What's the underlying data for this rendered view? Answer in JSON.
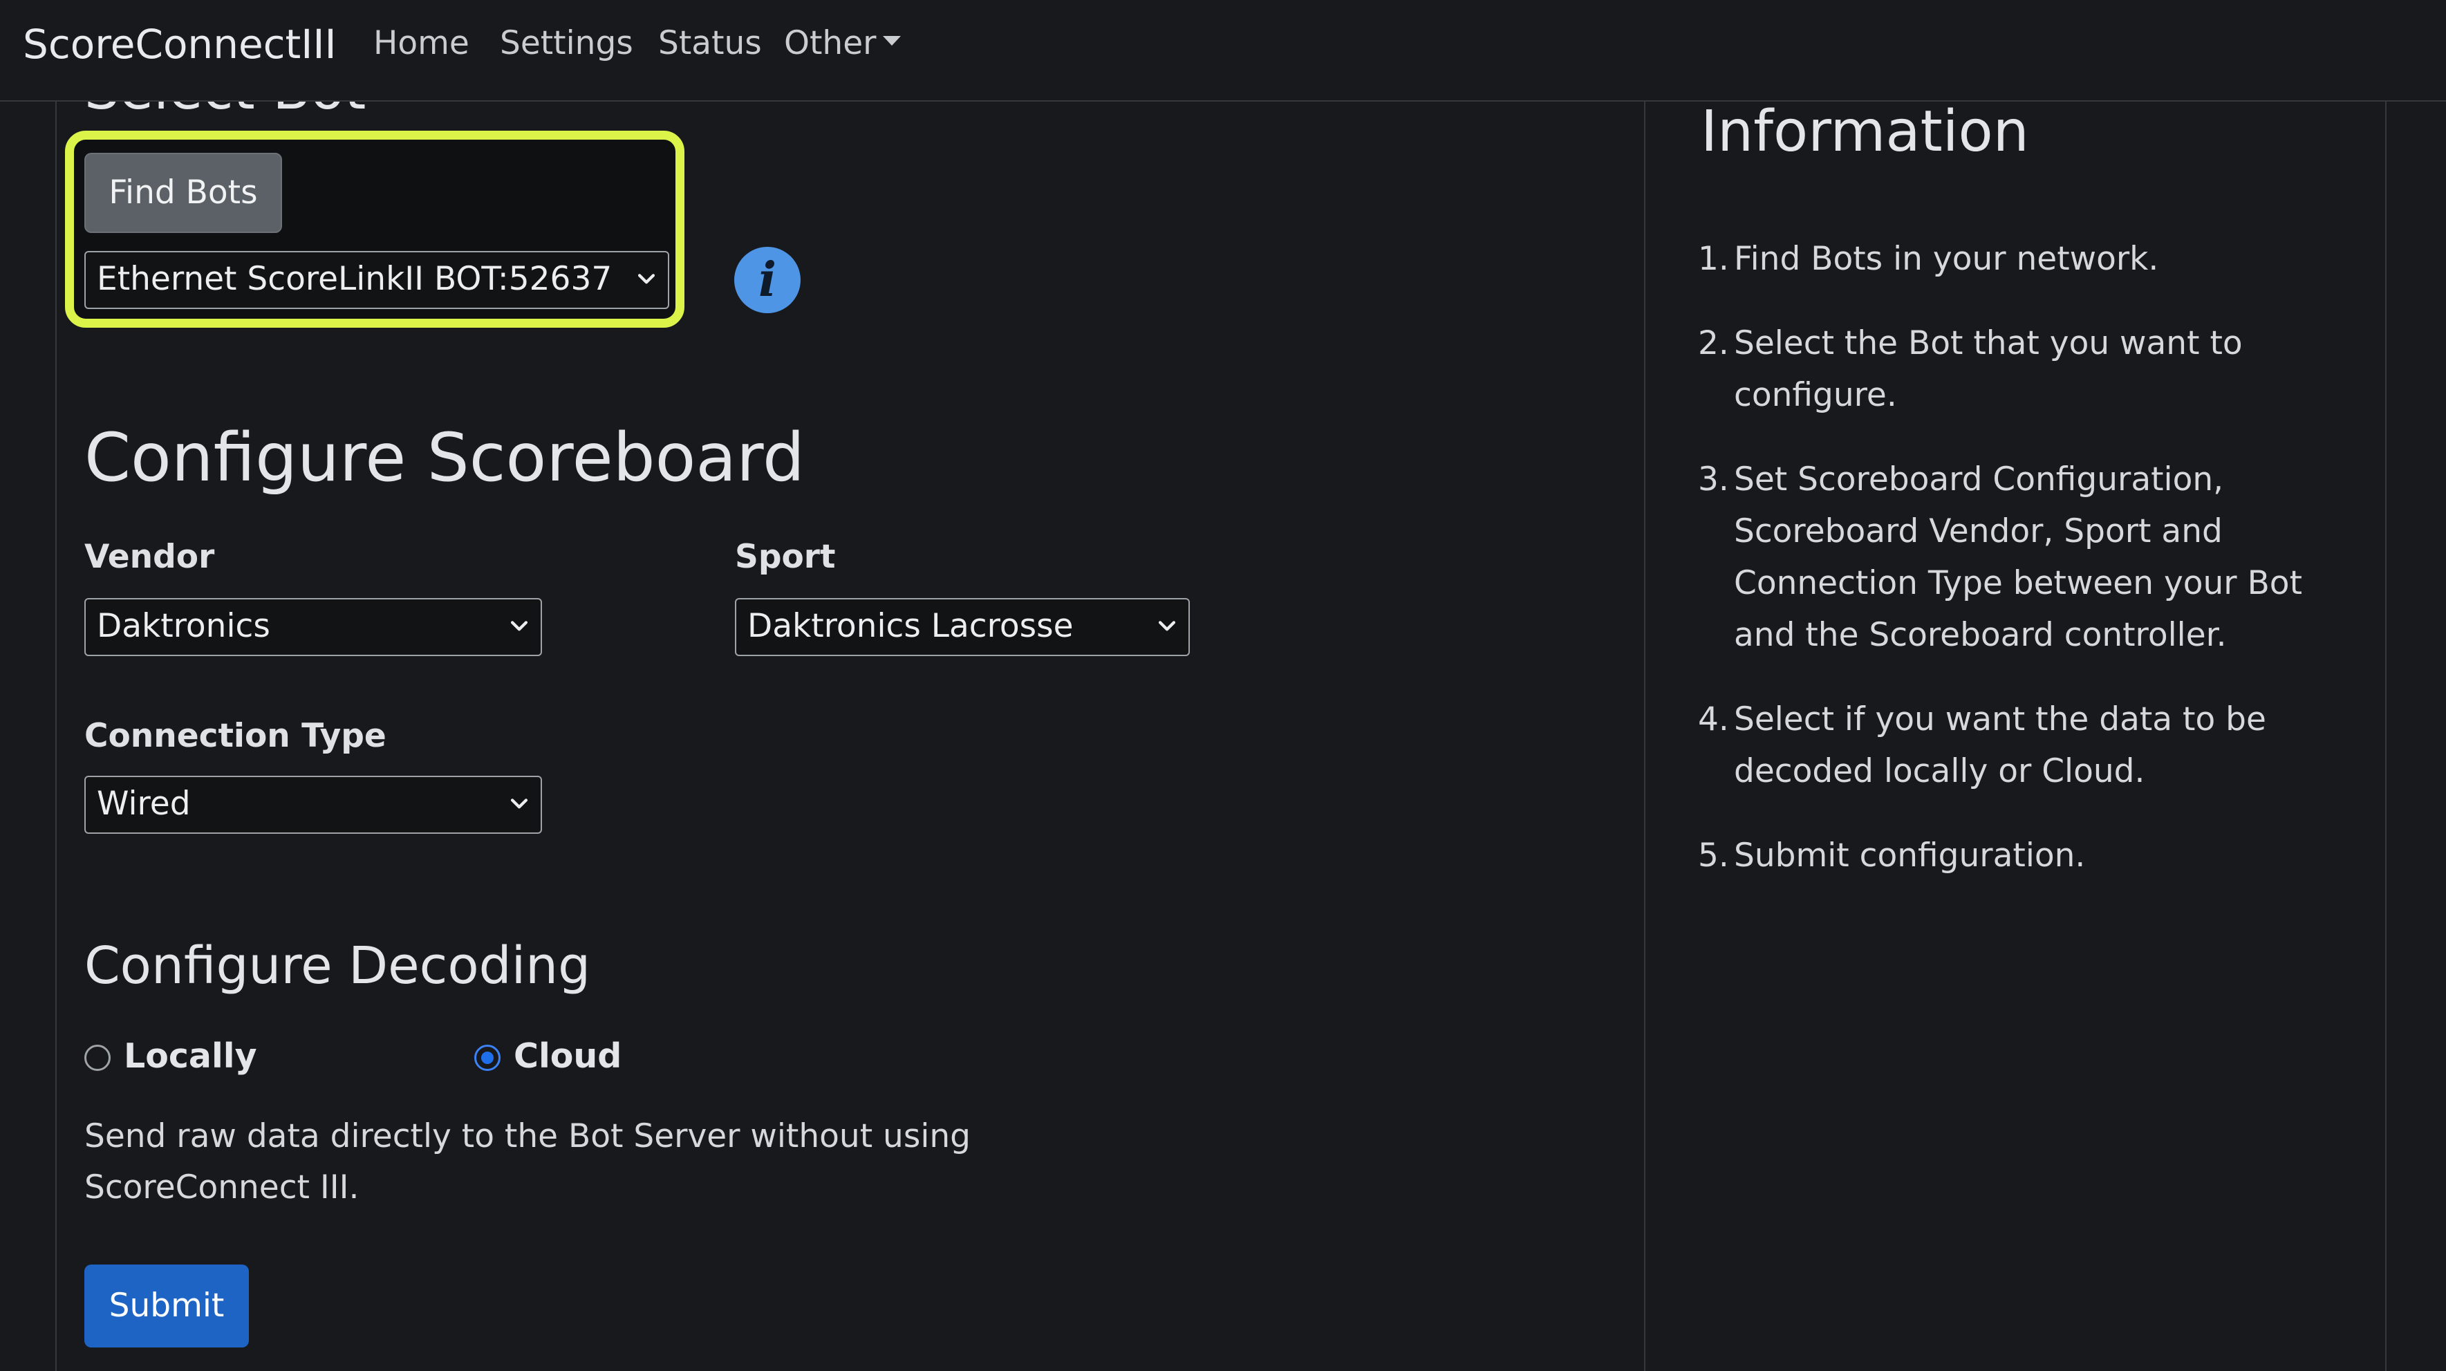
{
  "navbar": {
    "brand": "ScoreConnectIII",
    "links": [
      "Home",
      "Settings",
      "Status",
      "Other"
    ]
  },
  "select_bot": {
    "heading": "Select Bot",
    "find_button": "Find Bots",
    "bot_select_value": "Ethernet ScoreLinkII BOT:52637",
    "info_icon_glyph": "i"
  },
  "configure_scoreboard": {
    "heading": "Configure Scoreboard",
    "vendor_label": "Vendor",
    "vendor_value": "Daktronics",
    "sport_label": "Sport",
    "sport_value": "Daktronics Lacrosse",
    "connection_label": "Connection Type",
    "connection_value": "Wired"
  },
  "configure_decoding": {
    "heading": "Configure Decoding",
    "options": [
      {
        "label": "Locally",
        "selected": false
      },
      {
        "label": "Cloud",
        "selected": true
      }
    ],
    "description": "Send raw data directly to the Bot Server without using ScoreConnect III."
  },
  "submit_label": "Submit",
  "information": {
    "title": "Information",
    "steps": [
      {
        "num": "1.",
        "text": "Find Bots in your network."
      },
      {
        "num": "2.",
        "text": "Select the Bot that you want to configure."
      },
      {
        "num": "3.",
        "text": "Set Scoreboard Configuration, Scoreboard Vendor, Sport and Connection Type between your Bot and the Scoreboard controller."
      },
      {
        "num": "4.",
        "text": "Select if you want the data to be decoded locally or Cloud."
      },
      {
        "num": "5.",
        "text": "Submit configuration."
      }
    ]
  },
  "colors": {
    "background": "#17191c",
    "highlight": "#dcf44a",
    "primary": "#1d64c4",
    "info_icon": "#4f95e6"
  }
}
